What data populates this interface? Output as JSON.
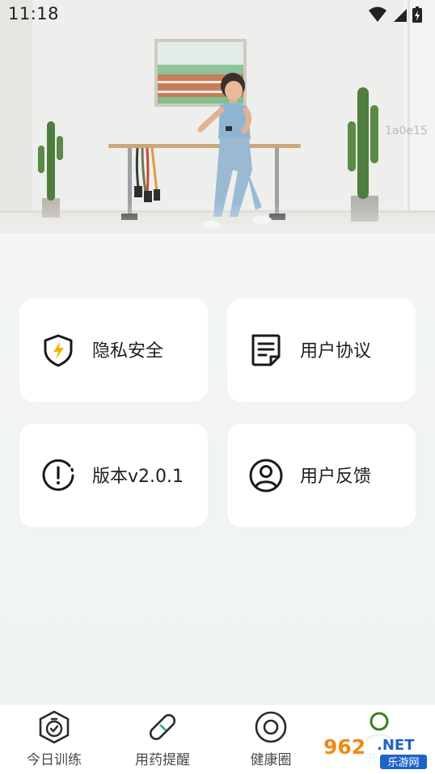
{
  "status_bar": {
    "time": "11:18",
    "icons": [
      "wifi-icon",
      "signal-icon",
      "battery-charging-icon"
    ]
  },
  "hero": {
    "image": "woman-walking-indoor-gym-illustration",
    "watermark": "1a0e15"
  },
  "settings": {
    "cards": [
      {
        "label": "隐私安全",
        "icon": "shield-lightning-icon"
      },
      {
        "label": "用户协议",
        "icon": "document-icon"
      },
      {
        "label": "版本v2.0.1",
        "icon": "info-alert-icon"
      },
      {
        "label": "用户反馈",
        "icon": "user-circle-icon"
      }
    ]
  },
  "bottom_nav": {
    "items": [
      {
        "label": "今日训练",
        "icon": "timer-badge-icon",
        "active": false
      },
      {
        "label": "用药提醒",
        "icon": "pill-icon",
        "active": false
      },
      {
        "label": "健康圈",
        "icon": "target-circle-icon",
        "active": false
      },
      {
        "label": "我的",
        "icon": "profile-icon",
        "active": true
      }
    ],
    "active_color": "#3a7d1e"
  },
  "brand_badge": {
    "logo_digits": "962",
    "logo_suffix": ".NET",
    "tagline": "乐游网"
  },
  "colors": {
    "card_bg": "#ffffff",
    "page_bg": "#f2f5f4",
    "text_primary": "#1f1f1f",
    "icon_stroke": "#1a1a1a",
    "shield_bolt": "#f2b300",
    "pill_accent": "#2fb39a",
    "brand_orange": "#f08a12",
    "brand_blue": "#1e64c8"
  }
}
